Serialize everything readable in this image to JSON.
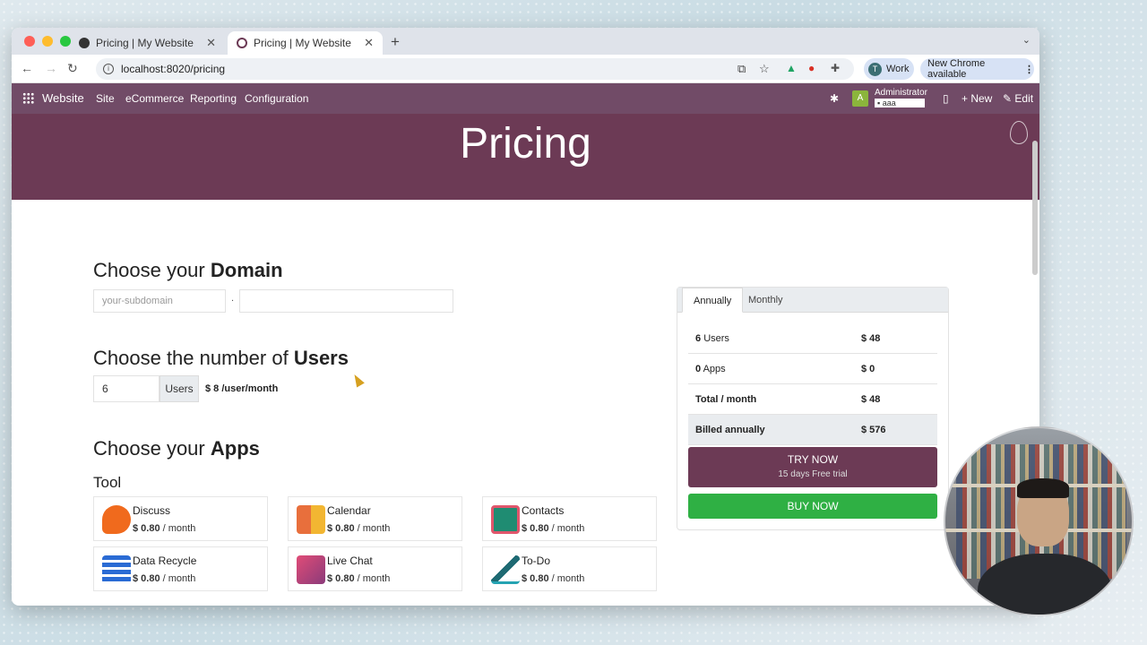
{
  "browser": {
    "tabs": [
      {
        "title": "Pricing | My Website",
        "active": false
      },
      {
        "title": "Pricing | My Website",
        "active": true
      }
    ],
    "url": "localhost:8020/pricing",
    "profile_label": "Work",
    "profile_initial": "T",
    "update_label": "New Chrome available"
  },
  "odoo": {
    "brand": "Website",
    "menu": [
      "Site",
      "eCommerce",
      "Reporting",
      "Configuration"
    ],
    "user_initial": "A",
    "user_name": "Administrator",
    "db_name": "aaa",
    "new_label": "New",
    "edit_label": "Edit"
  },
  "page": {
    "title": "Pricing",
    "domain": {
      "heading_prefix": "Choose your",
      "heading_bold": "Domain",
      "subdomain_placeholder": "your-subdomain",
      "dot": "."
    },
    "users": {
      "heading_prefix": "Choose the number of",
      "heading_bold": "Users",
      "count": "6",
      "unit_label": "Users",
      "price": "$ 8 /user/month"
    },
    "apps": {
      "heading_prefix": "Choose your",
      "heading_bold": "Apps",
      "category": "Tool",
      "items": [
        {
          "name": "Discuss",
          "price": "$ 0.80",
          "period": "/ month"
        },
        {
          "name": "Calendar",
          "price": "$ 0.80",
          "period": "/ month"
        },
        {
          "name": "Contacts",
          "price": "$ 0.80",
          "period": "/ month"
        },
        {
          "name": "Data Recycle",
          "price": "$ 0.80",
          "period": "/ month"
        },
        {
          "name": "Live Chat",
          "price": "$ 0.80",
          "period": "/ month"
        },
        {
          "name": "To-Do",
          "price": "$ 0.80",
          "period": "/ month"
        }
      ]
    },
    "summary": {
      "tab_annually": "Annually",
      "tab_monthly": "Monthly",
      "rows": [
        {
          "count": "6",
          "label": "Users",
          "value": "$ 48"
        },
        {
          "count": "0",
          "label": "Apps",
          "value": "$ 0"
        }
      ],
      "total_label": "Total / month",
      "total_value": "$ 48",
      "billed_label": "Billed annually",
      "billed_value": "$ 576",
      "try_label": "TRY NOW",
      "trial_label": "15 days Free trial",
      "buy_label": "BUY NOW"
    }
  },
  "colors": {
    "odoo_purple": "#714b67",
    "hero": "#6c3a55",
    "buy_green": "#2fb044"
  }
}
